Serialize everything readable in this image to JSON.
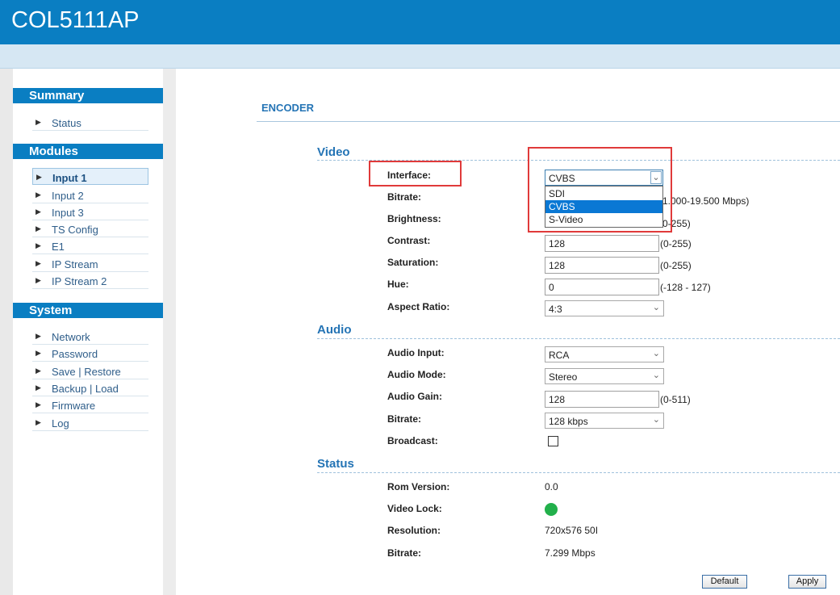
{
  "app": {
    "title": "COL5111AP"
  },
  "sidebar": {
    "summary": {
      "title": "Summary",
      "items": [
        {
          "label": "Status"
        }
      ]
    },
    "modules": {
      "title": "Modules",
      "items": [
        {
          "label": "Input 1",
          "active": true
        },
        {
          "label": "Input 2"
        },
        {
          "label": "Input 3"
        },
        {
          "label": "TS Config"
        },
        {
          "label": "E1"
        },
        {
          "label": "IP Stream"
        },
        {
          "label": "IP Stream 2"
        }
      ]
    },
    "system": {
      "title": "System",
      "items": [
        {
          "label": "Network"
        },
        {
          "label": "Password"
        },
        {
          "label": "Save | Restore"
        },
        {
          "label": "Backup | Load"
        },
        {
          "label": "Firmware"
        },
        {
          "label": "Log"
        }
      ]
    }
  },
  "main": {
    "title": "ENCODER",
    "video": {
      "title": "Video",
      "interface": {
        "label": "Interface:",
        "value": "CVBS",
        "options": [
          "SDI",
          "CVBS",
          "S-Video"
        ],
        "selected_option": "CVBS"
      },
      "bitrate": {
        "label": "Bitrate:",
        "range": "1.000-19.500 Mbps)"
      },
      "brightness": {
        "label": "Brightness:",
        "range": "0-255)"
      },
      "contrast": {
        "label": "Contrast:",
        "value": "128",
        "range": "(0-255)"
      },
      "saturation": {
        "label": "Saturation:",
        "value": "128",
        "range": "(0-255)"
      },
      "hue": {
        "label": "Hue:",
        "value": "0",
        "range": "(-128 - 127)"
      },
      "aspect_ratio": {
        "label": "Aspect Ratio:",
        "value": "4:3"
      }
    },
    "audio": {
      "title": "Audio",
      "input": {
        "label": "Audio Input:",
        "value": "RCA"
      },
      "mode": {
        "label": "Audio Mode:",
        "value": "Stereo"
      },
      "gain": {
        "label": "Audio Gain:",
        "value": "128",
        "range": "(0-511)"
      },
      "bitrate": {
        "label": "Bitrate:",
        "value": "128 kbps"
      },
      "broadcast": {
        "label": "Broadcast:",
        "checked": false
      }
    },
    "status": {
      "title": "Status",
      "rom_version": {
        "label": "Rom Version:",
        "value": "0.0"
      },
      "video_lock": {
        "label": "Video Lock:",
        "color": "#22b04b"
      },
      "resolution": {
        "label": "Resolution:",
        "value": "720x576 50I"
      },
      "bitrate": {
        "label": "Bitrate:",
        "value": "7.299 Mbps"
      }
    },
    "buttons": {
      "default": "Default",
      "apply": "Apply"
    }
  },
  "colors": {
    "brand": "#0a7ec2",
    "highlight": "#e03a3a",
    "accent_text": "#2474b5"
  }
}
